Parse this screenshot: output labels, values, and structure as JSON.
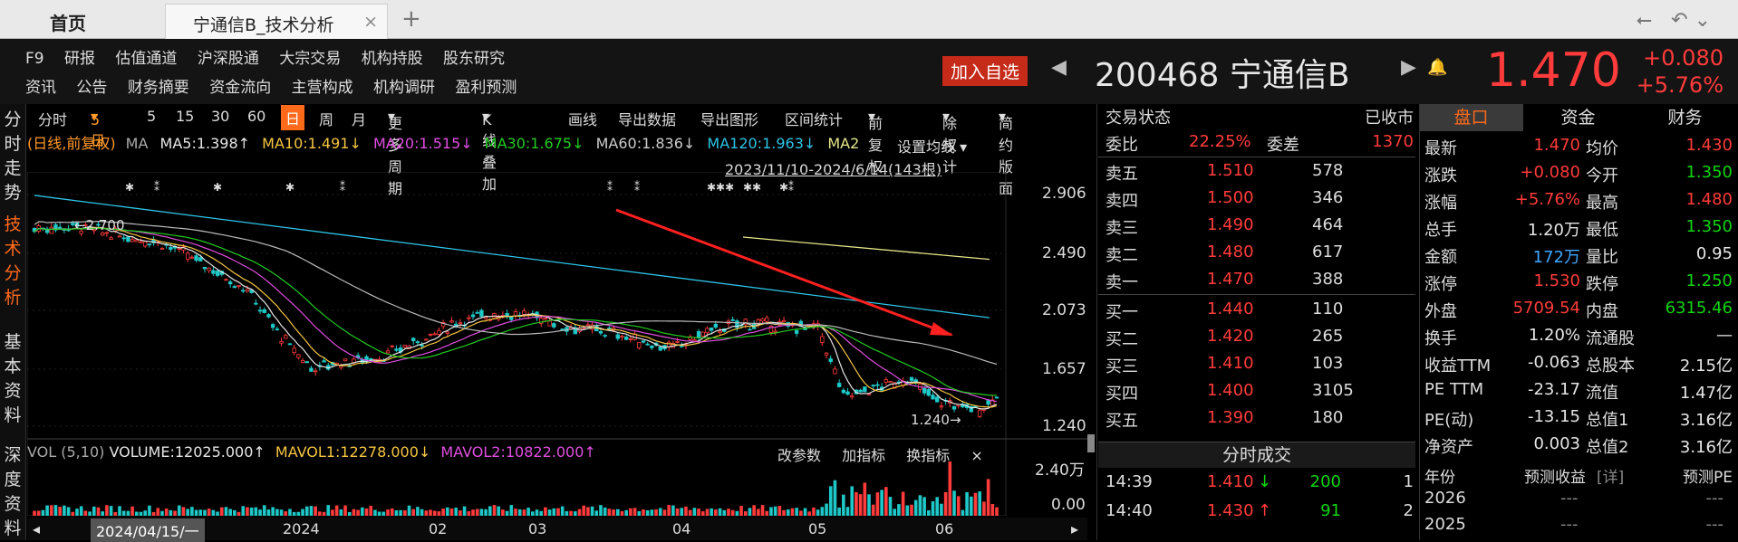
{
  "tabs": {
    "home": "首页",
    "active": "宁通信B_技术分析",
    "close": "×",
    "plus": "+"
  },
  "nav_icons": [
    "⭠",
    "↶",
    "⌄"
  ],
  "menu": {
    "row1": [
      "F9",
      "研报",
      "估值通道",
      "沪深股通",
      "大宗交易",
      "机构持股",
      "股东研究"
    ],
    "row2": [
      "资讯",
      "公告",
      "财务摘要",
      "资金流向",
      "主营构成",
      "机构调研",
      "盈利预测"
    ]
  },
  "stock": {
    "add_fav": "加入自选",
    "code_name": "200468 宁通信B",
    "price": "1.470",
    "change": "+0.080",
    "change_pct": "+5.76%"
  },
  "vtabs": [
    {
      "text": "分时走势",
      "active": false
    },
    {
      "text": "技术分析",
      "active": true
    },
    {
      "text": "基本资料",
      "active": false
    },
    {
      "text": "深度资料",
      "active": false
    }
  ],
  "chart_toolbar": [
    "分时",
    "5日",
    "5",
    "15",
    "30",
    "60",
    "日",
    "周",
    "月",
    "更多周期",
    "K线叠加",
    "画线",
    "导出数据",
    "导出图形",
    "区间统计",
    "前复权",
    "除权计",
    "简约版面"
  ],
  "ma": {
    "label": "(日线,前复权)",
    "ma": "MA",
    "items": [
      {
        "text": "MA5:1.398↑",
        "color": "#e6e6e6"
      },
      {
        "text": "MA10:1.491↓",
        "color": "#f5c542"
      },
      {
        "text": "MA20:1.515↓",
        "color": "#e04fe0"
      },
      {
        "text": "MA30:1.675↓",
        "color": "#22cc22"
      },
      {
        "text": "MA60:1.836↓",
        "color": "#cccccc"
      },
      {
        "text": "MA120:1.963↓",
        "color": "#2ec4e6"
      },
      {
        "text": "MA2",
        "color": "#e6e68a"
      }
    ],
    "settings": "设置均线 ▾"
  },
  "date_range": "2023/11/10-2024/6/14(143根)",
  "yaxis": [
    "2.906",
    "2.490",
    "2.073",
    "1.657",
    "1.240"
  ],
  "annotations": {
    "high": "2.700",
    "low": "1.240"
  },
  "vol": {
    "label": "VOL (5,10)",
    "volume": "VOLUME:12025.000↑",
    "mavol1": "MAVOL1:12278.000↓",
    "mavol2": "MAVOL2:10822.000↑",
    "actions": [
      "改参数",
      "加指标",
      "换指标",
      "×"
    ],
    "yaxis": [
      "2.40万",
      "0.00"
    ]
  },
  "xaxis": {
    "cursor": "2024/04/15/一",
    "labels": [
      "2024",
      "02",
      "03",
      "04",
      "05",
      "06"
    ]
  },
  "book": {
    "status_label": "交易状态",
    "status_value": "已收市",
    "weibi_label": "委比",
    "weibi_value": "22.25%",
    "weicha_label": "委差",
    "weicha_value": "1370",
    "sells": [
      {
        "label": "卖五",
        "price": "1.510",
        "vol": "578"
      },
      {
        "label": "卖四",
        "price": "1.500",
        "vol": "346"
      },
      {
        "label": "卖三",
        "price": "1.490",
        "vol": "464"
      },
      {
        "label": "卖二",
        "price": "1.480",
        "vol": "617"
      },
      {
        "label": "卖一",
        "price": "1.470",
        "vol": "388"
      }
    ],
    "buys": [
      {
        "label": "买一",
        "price": "1.440",
        "vol": "110"
      },
      {
        "label": "买二",
        "price": "1.420",
        "vol": "265"
      },
      {
        "label": "买三",
        "price": "1.410",
        "vol": "103"
      },
      {
        "label": "买四",
        "price": "1.400",
        "vol": "3105"
      },
      {
        "label": "买五",
        "price": "1.390",
        "vol": "180"
      }
    ],
    "trades_title": "分时成交",
    "trades": [
      {
        "time": "14:39",
        "price": "1.410",
        "dir": "↓",
        "vol": "200",
        "n": "1",
        "up": false
      },
      {
        "time": "14:40",
        "price": "1.430",
        "dir": "↑",
        "vol": "91",
        "n": "2",
        "up": true
      }
    ]
  },
  "right_panel": {
    "tabs": [
      "盘口",
      "资金",
      "财务"
    ],
    "rows": [
      {
        "l1": "最新",
        "v1": "1.470",
        "c1": "red",
        "l2": "均价",
        "v2": "1.430",
        "c2": "red"
      },
      {
        "l1": "涨跌",
        "v1": "+0.080",
        "c1": "red",
        "l2": "今开",
        "v2": "1.350",
        "c2": "green"
      },
      {
        "l1": "涨幅",
        "v1": "+5.76%",
        "c1": "red",
        "l2": "最高",
        "v2": "1.480",
        "c2": "red"
      },
      {
        "l1": "总手",
        "v1": "1.20万",
        "c1": "white",
        "l2": "最低",
        "v2": "1.350",
        "c2": "green"
      },
      {
        "l1": "金额",
        "v1": "172万",
        "c1": "blue",
        "l2": "量比",
        "v2": "0.95",
        "c2": "white"
      },
      {
        "l1": "涨停",
        "v1": "1.530",
        "c1": "red",
        "l2": "跌停",
        "v2": "1.250",
        "c2": "green"
      },
      {
        "l1": "外盘",
        "v1": "5709.54",
        "c1": "red",
        "l2": "内盘",
        "v2": "6315.46",
        "c2": "green"
      },
      {
        "l1": "换手",
        "v1": "1.20%",
        "c1": "white",
        "l2": "流通股",
        "v2": "—",
        "c2": "white"
      },
      {
        "l1": "收益TTM",
        "v1": "-0.063",
        "c1": "white",
        "l2": "总股本",
        "v2": "2.15亿",
        "c2": "white"
      },
      {
        "l1": "PE TTM",
        "v1": "-23.17",
        "c1": "white",
        "l2": "流值",
        "v2": "1.47亿",
        "c2": "white"
      },
      {
        "l1": "PE(动)",
        "v1": "-13.15",
        "c1": "white",
        "l2": "总值1",
        "v2": "3.16亿",
        "c2": "white"
      },
      {
        "l1": "净资产",
        "v1": "0.003",
        "c1": "white",
        "l2": "总值2",
        "v2": "3.16亿",
        "c2": "white"
      }
    ],
    "forecast_header": [
      "年份",
      "预测收益",
      "[详]",
      "预测PE"
    ],
    "forecast": [
      {
        "year": "2026",
        "eps": "---",
        "pe": "---"
      },
      {
        "year": "2025",
        "eps": "---",
        "pe": "---"
      }
    ]
  }
}
